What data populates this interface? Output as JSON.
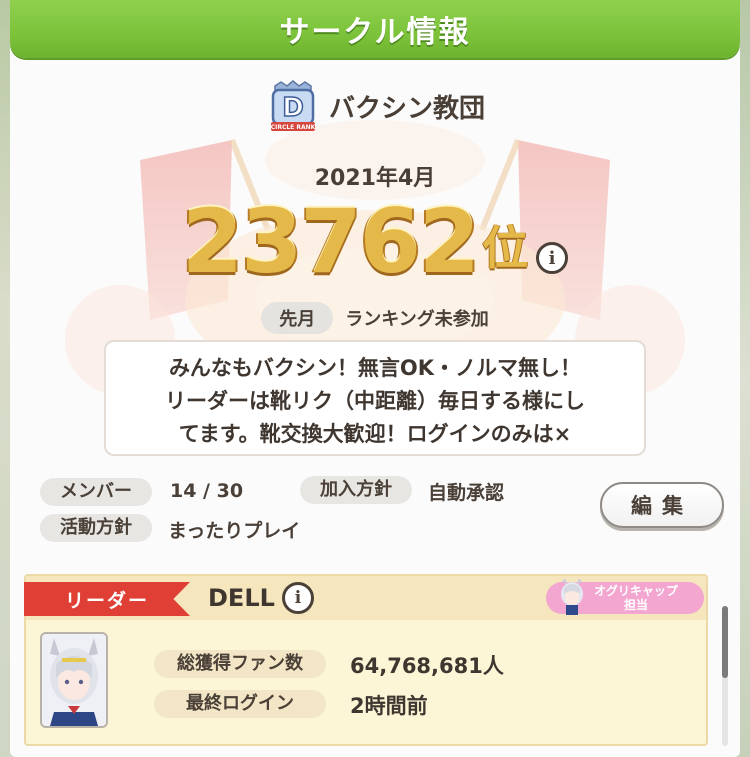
{
  "header": {
    "title": "サークル情報"
  },
  "circle": {
    "name": "バクシン教団",
    "rank_badge_letter": "D",
    "rank_badge_caption": "CIRCLE RANK"
  },
  "ranking": {
    "month": "2021年4月",
    "rank": "23762",
    "rank_suffix": "位",
    "info_icon": "i",
    "previous_label": "先月",
    "previous_value": "ランキング未参加"
  },
  "comment": "みんなもバクシン！無言OK・ノルマ無し！\nリーダーは靴リク（中距離）毎日する様にし\nてます。靴交換大歓迎！ログインのみは×",
  "details": {
    "members_label": "メンバー",
    "members_value": "14 / 30",
    "join_policy_label": "加入方針",
    "join_policy_value": "自動承認",
    "activity_label": "活動方針",
    "activity_value": "まったりプレイ",
    "edit_label": "編集"
  },
  "leader": {
    "ribbon_label": "リーダー",
    "name": "DELL",
    "info_icon": "i",
    "trainer_badge_line1": "オグリキャップ",
    "trainer_badge_line2": "担当",
    "fans_label": "総獲得ファン数",
    "fans_value": "64,768,681人",
    "last_login_label": "最終ログイン",
    "last_login_value": "2時間前"
  },
  "colors": {
    "header_green": "#7cc23a",
    "rank_gold": "#e4b94a",
    "leader_ribbon": "#e03f35",
    "trainer_badge": "#f3a6d0"
  }
}
